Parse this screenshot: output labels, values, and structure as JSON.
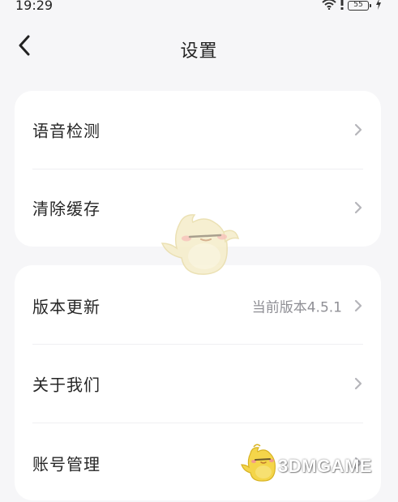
{
  "status_bar": {
    "time": "19:29",
    "battery": "55",
    "icons": [
      "wifi-icon",
      "alert-icon",
      "battery-icon",
      "charging-icon"
    ]
  },
  "header": {
    "title": "设置",
    "back_icon": "chevron-left-icon"
  },
  "group1": {
    "items": [
      {
        "label": "语音检测"
      },
      {
        "label": "清除缓存"
      }
    ]
  },
  "group2": {
    "items": [
      {
        "label": "版本更新",
        "value": "当前版本4.5.1"
      },
      {
        "label": "关于我们"
      },
      {
        "label": "账号管理"
      }
    ]
  },
  "watermark": {
    "text": "3DMGAME"
  },
  "colors": {
    "background": "#f6f6f8",
    "card": "#ffffff",
    "text": "#262626",
    "secondary_text": "#8f8f95",
    "chevron": "#b5b5ba"
  }
}
